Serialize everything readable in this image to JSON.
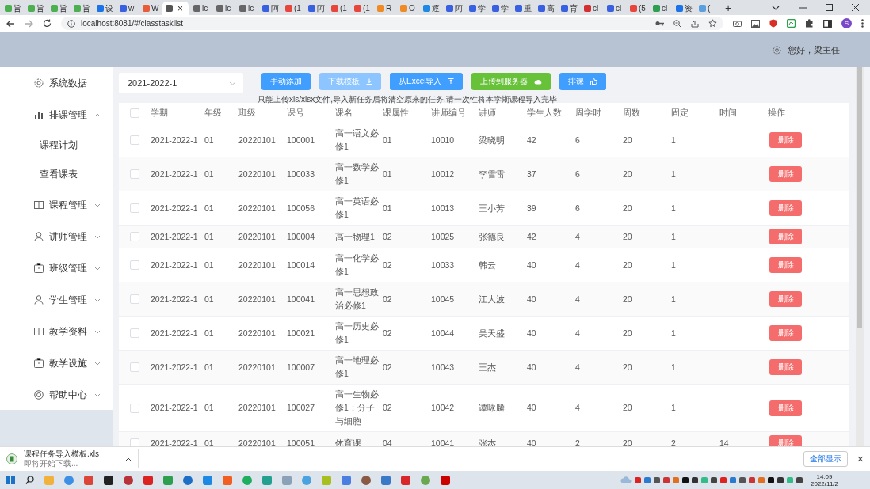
{
  "browser": {
    "tabs": [
      {
        "title": "旨",
        "selected": false
      },
      {
        "title": "旨",
        "selected": false
      },
      {
        "title": "旨",
        "selected": false
      },
      {
        "title": "旨",
        "selected": false
      },
      {
        "title": "设",
        "selected": false
      },
      {
        "title": "w",
        "selected": false
      },
      {
        "title": "W",
        "selected": false
      },
      {
        "close": "×",
        "selected": true
      },
      {
        "title": "lc",
        "selected": false
      },
      {
        "title": "lc",
        "selected": false
      },
      {
        "title": "lc",
        "selected": false
      },
      {
        "title": "阿",
        "selected": false
      },
      {
        "title": "(1",
        "selected": false
      },
      {
        "title": "阿",
        "selected": false
      },
      {
        "title": "(1",
        "selected": false
      },
      {
        "title": "(1",
        "selected": false
      },
      {
        "title": "R",
        "selected": false
      },
      {
        "title": "O",
        "selected": false
      },
      {
        "title": "逐",
        "selected": false
      },
      {
        "title": "阿",
        "selected": false
      },
      {
        "title": "学",
        "selected": false
      },
      {
        "title": "学",
        "selected": false
      },
      {
        "title": "重",
        "selected": false
      },
      {
        "title": "高",
        "selected": false
      },
      {
        "title": "育",
        "selected": false
      },
      {
        "title": "cl",
        "selected": false
      },
      {
        "title": "cl",
        "selected": false
      },
      {
        "title": "(5",
        "selected": false
      },
      {
        "title": "cl",
        "selected": false
      },
      {
        "title": "资",
        "selected": false
      },
      {
        "title": "(",
        "selected": false
      }
    ],
    "new_tab": "+",
    "url": "localhost:8081/#/classtasklist",
    "profile": "S"
  },
  "header": {
    "greeting": "您好，梁主任"
  },
  "sidebar": {
    "items": [
      {
        "label": "系统数据"
      },
      {
        "label": "排课管理",
        "expanded": true,
        "children": [
          {
            "label": "课程计划"
          },
          {
            "label": "查看课表"
          }
        ]
      },
      {
        "label": "课程管理",
        "expanded": false
      },
      {
        "label": "讲师管理",
        "expanded": false
      },
      {
        "label": "班级管理",
        "expanded": false
      },
      {
        "label": "学生管理",
        "expanded": false
      },
      {
        "label": "教学资料",
        "expanded": false
      },
      {
        "label": "教学设施",
        "expanded": false
      },
      {
        "label": "帮助中心",
        "expanded": false
      }
    ]
  },
  "toolbar": {
    "term_select": "2021-2022-1",
    "buttons": [
      {
        "label": "手动添加",
        "kind": "primary",
        "disabled": false
      },
      {
        "label": "下载模板",
        "kind": "primary",
        "disabled": true
      },
      {
        "label": "从Excel导入",
        "kind": "primary",
        "disabled": false
      },
      {
        "label": "上传到服务器",
        "kind": "success",
        "disabled": false
      },
      {
        "label": "排课",
        "kind": "primary",
        "disabled": false
      }
    ],
    "hint": "只能上传xls/xlsx文件,导入新任务后将清空原来的任务,请一次性将本学期课程导入完毕"
  },
  "table": {
    "all_checked": false,
    "columns": [
      "学期",
      "年级",
      "班级",
      "课号",
      "课名",
      "课属性",
      "讲师编号",
      "讲师",
      "学生人数",
      "周学时",
      "周数",
      "固定",
      "时间",
      "操作"
    ],
    "rows": [
      {
        "checked": false,
        "term": "2021-2022-1",
        "grade": "01",
        "class": "20220101",
        "course_no": "100001",
        "course_name": "高一语文必修1",
        "attribute": "01",
        "teacher_no": "10010",
        "teacher": "梁晓明",
        "students": "42",
        "weekly_hours": "6",
        "weeks": "20",
        "fixed": "1",
        "action": "删除"
      },
      {
        "checked": false,
        "term": "2021-2022-1",
        "grade": "01",
        "class": "20220101",
        "course_no": "100033",
        "course_name": "高一数学必修1",
        "attribute": "01",
        "teacher_no": "10012",
        "teacher": "李雪雷",
        "students": "37",
        "weekly_hours": "6",
        "weeks": "20",
        "fixed": "1",
        "action": "删除"
      },
      {
        "checked": false,
        "term": "2021-2022-1",
        "grade": "01",
        "class": "20220101",
        "course_no": "100056",
        "course_name": "高一英语必修1",
        "attribute": "01",
        "teacher_no": "10013",
        "teacher": "王小芳",
        "students": "39",
        "weekly_hours": "6",
        "weeks": "20",
        "fixed": "1",
        "action": "删除"
      },
      {
        "checked": false,
        "term": "2021-2022-1",
        "grade": "01",
        "class": "20220101",
        "course_no": "100004",
        "course_name": "高一物理1",
        "attribute": "02",
        "teacher_no": "10025",
        "teacher": "张德良",
        "students": "42",
        "weekly_hours": "4",
        "weeks": "20",
        "fixed": "1",
        "action": "删除"
      },
      {
        "checked": false,
        "term": "2021-2022-1",
        "grade": "01",
        "class": "20220101",
        "course_no": "100014",
        "course_name": "高一化学必修1",
        "attribute": "02",
        "teacher_no": "10033",
        "teacher": "韩云",
        "students": "40",
        "weekly_hours": "4",
        "weeks": "20",
        "fixed": "1",
        "action": "删除"
      },
      {
        "checked": false,
        "term": "2021-2022-1",
        "grade": "01",
        "class": "20220101",
        "course_no": "100041",
        "course_name": "高一思想政治必修1",
        "attribute": "02",
        "teacher_no": "10045",
        "teacher": "江大波",
        "students": "40",
        "weekly_hours": "4",
        "weeks": "20",
        "fixed": "1",
        "action": "删除"
      },
      {
        "checked": false,
        "term": "2021-2022-1",
        "grade": "01",
        "class": "20220101",
        "course_no": "100021",
        "course_name": "高一历史必修1",
        "attribute": "02",
        "teacher_no": "10044",
        "teacher": "吴天盛",
        "students": "40",
        "weekly_hours": "4",
        "weeks": "20",
        "fixed": "1",
        "action": "删除"
      },
      {
        "checked": false,
        "term": "2021-2022-1",
        "grade": "01",
        "class": "20220101",
        "course_no": "100007",
        "course_name": "高一地理必修1",
        "attribute": "02",
        "teacher_no": "10043",
        "teacher": "王杰",
        "students": "40",
        "weekly_hours": "4",
        "weeks": "20",
        "fixed": "1",
        "action": "删除"
      },
      {
        "checked": false,
        "term": "2021-2022-1",
        "grade": "01",
        "class": "20220101",
        "course_no": "100027",
        "course_name": "高一生物必修1：分子与细胞",
        "attribute": "02",
        "teacher_no": "10042",
        "teacher": "谭咏麟",
        "students": "40",
        "weekly_hours": "4",
        "weeks": "20",
        "fixed": "1",
        "action": "删除"
      },
      {
        "checked": false,
        "term": "2021-2022-1",
        "grade": "01",
        "class": "20220101",
        "course_no": "100051",
        "course_name": "体育课",
        "attribute": "04",
        "teacher_no": "10041",
        "teacher": "张杰",
        "students": "40",
        "weekly_hours": "2",
        "weeks": "20",
        "fixed": "2",
        "time": "14",
        "action": "删除"
      }
    ]
  },
  "download_bar": {
    "file": "课程任务导入模板.xls",
    "status": "即将开始下载...",
    "show_all": "全部显示",
    "close": "×"
  },
  "taskbar": {
    "time": "14:09",
    "date": "2022/11/2"
  }
}
